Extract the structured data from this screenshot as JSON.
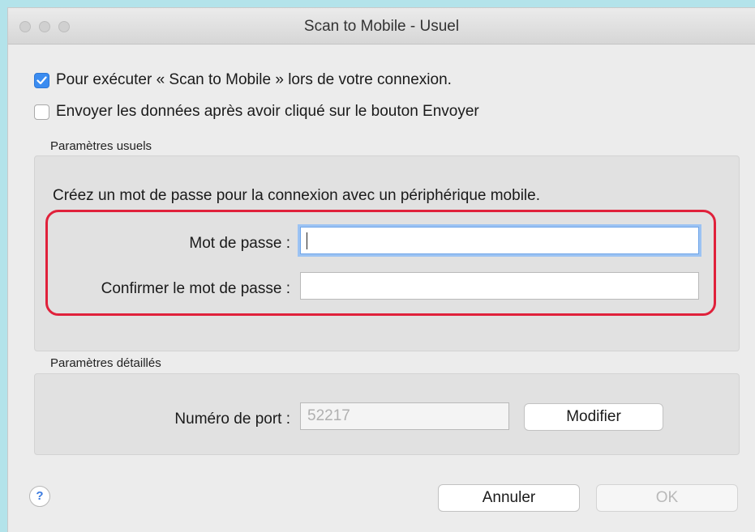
{
  "window": {
    "title": "Scan to Mobile - Usuel"
  },
  "options": {
    "launch_on_login": {
      "label": "Pour exécuter « Scan to Mobile » lors de votre connexion.",
      "checked": true
    },
    "send_after_click": {
      "label": "Envoyer les données après avoir cliqué sur le bouton Envoyer",
      "checked": false
    }
  },
  "usual_settings": {
    "group_label": "Paramètres usuels",
    "instruction": "Créez un mot de passe pour la connexion avec un périphérique mobile.",
    "password_label": "Mot de passe :",
    "password_value": "",
    "confirm_label": "Confirmer le mot de passe :",
    "confirm_value": ""
  },
  "detailed_settings": {
    "group_label": "Paramètres détaillés",
    "port_label": "Numéro de port :",
    "port_value": "52217",
    "modify_label": "Modifier"
  },
  "footer": {
    "help_label": "?",
    "cancel_label": "Annuler",
    "ok_label": "OK"
  },
  "colors": {
    "accent": "#3b8cf0",
    "highlight": "#e0213b",
    "background": "#b3e3ea"
  }
}
